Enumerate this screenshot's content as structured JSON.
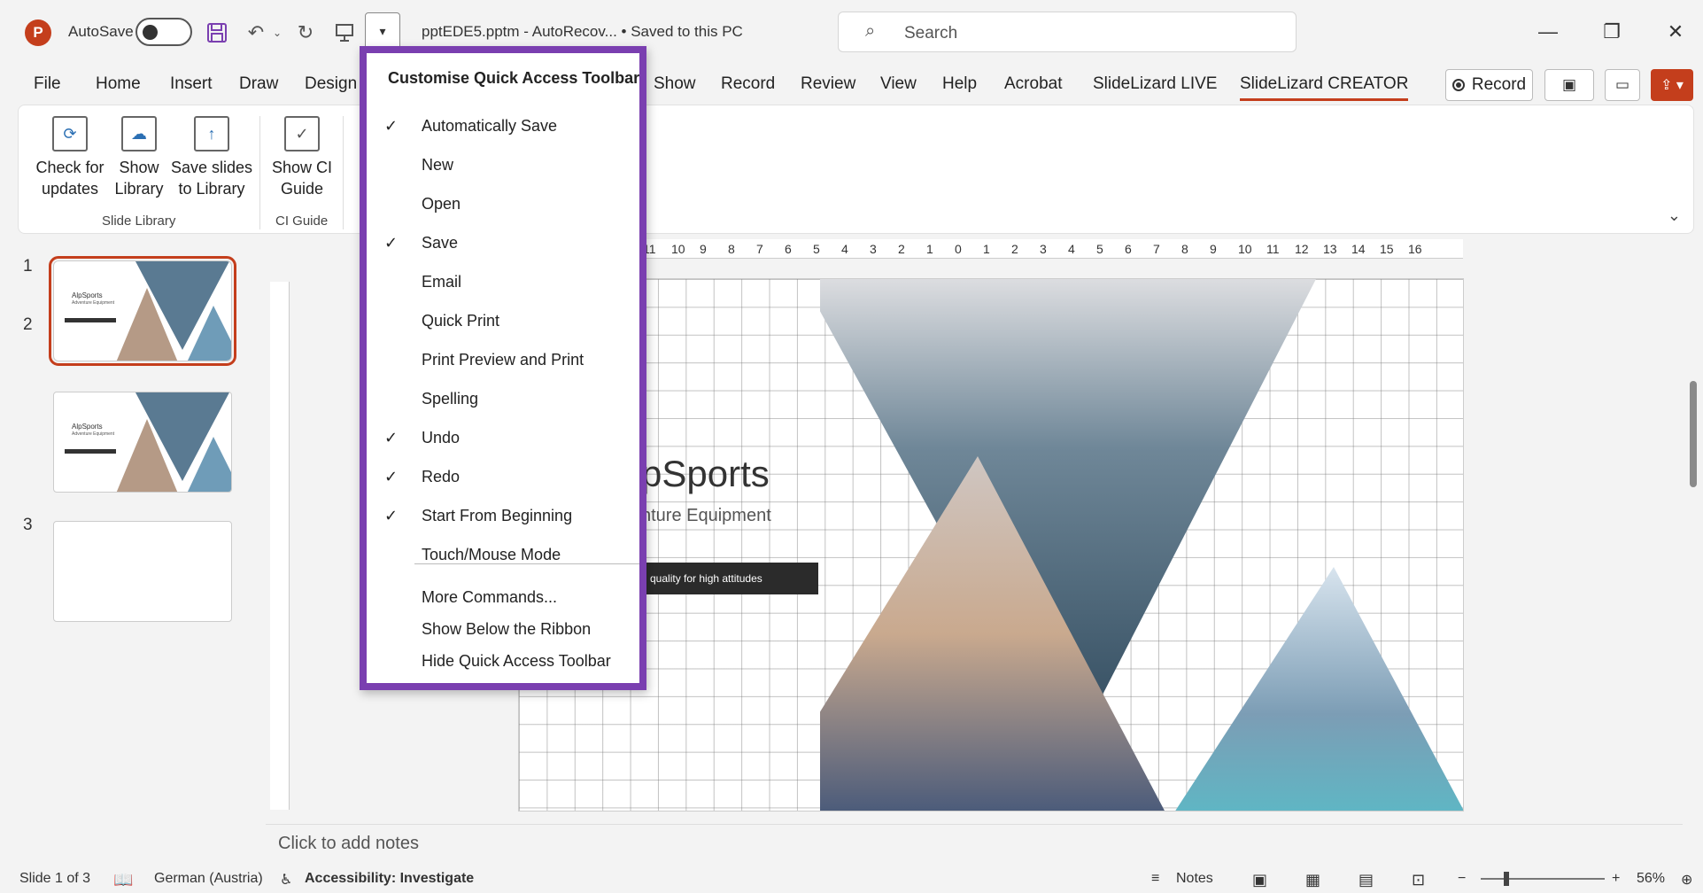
{
  "app": {
    "autosave_label": "AutoSave",
    "filename": "pptEDE5.pptm  -  AutoRecov...  •  Saved to this PC",
    "search_placeholder": "Search"
  },
  "tabs": [
    "File",
    "Home",
    "Insert",
    "Draw",
    "Design",
    "Show",
    "Record",
    "Review",
    "View",
    "Help",
    "Acrobat",
    "SlideLizard LIVE",
    "SlideLizard CREATOR"
  ],
  "active_tab": "SlideLizard CREATOR",
  "record_button": "Record",
  "ribbon": {
    "buttons": [
      {
        "line1": "Check for",
        "line2": "updates"
      },
      {
        "line1": "Show",
        "line2": "Library"
      },
      {
        "line1": "Save slides",
        "line2": "to Library"
      },
      {
        "line1": "Show CI",
        "line2": "Guide"
      }
    ],
    "groups": [
      "Slide Library",
      "CI Guide"
    ]
  },
  "slides": [
    {
      "number": "1",
      "title": "AlpSports",
      "subtitle": "Adventure Equipment",
      "bar": "High quality for high attitudes"
    },
    {
      "number": "2",
      "title": "AlpSports",
      "subtitle": "Adventure Equipment",
      "bar": "High quality for high attitudes"
    },
    {
      "number": "3"
    }
  ],
  "slide_content": {
    "title": "pSports",
    "subtitle": "nture Equipment",
    "bar": "quality for high attitudes"
  },
  "ruler_ticks": [
    "12",
    "11",
    "10",
    "9",
    "8",
    "7",
    "6",
    "5",
    "4",
    "3",
    "2",
    "1",
    "0",
    "1",
    "2",
    "3",
    "4",
    "5",
    "6",
    "7",
    "8",
    "9",
    "10",
    "11",
    "12",
    "13",
    "14",
    "15",
    "16"
  ],
  "qat_menu": {
    "header": "Customise Quick Access Toolbar",
    "items": [
      {
        "label": "Automatically Save",
        "checked": true
      },
      {
        "label": "New",
        "checked": false
      },
      {
        "label": "Open",
        "checked": false
      },
      {
        "label": "Save",
        "checked": true
      },
      {
        "label": "Email",
        "checked": false
      },
      {
        "label": "Quick Print",
        "checked": false
      },
      {
        "label": "Print Preview and Print",
        "checked": false
      },
      {
        "label": "Spelling",
        "checked": false
      },
      {
        "label": "Undo",
        "checked": true
      },
      {
        "label": "Redo",
        "checked": true
      },
      {
        "label": "Start From Beginning",
        "checked": true
      },
      {
        "label": "Touch/Mouse Mode",
        "checked": false
      }
    ],
    "extra_items": [
      "More Commands...",
      "Show Below the Ribbon",
      "Hide Quick Access Toolbar"
    ],
    "check_glyph": "✓"
  },
  "notes_placeholder": "Click to add notes",
  "statusbar": {
    "slide_info": "Slide 1 of 3",
    "language": "German (Austria)",
    "accessibility": "Accessibility: Investigate",
    "notes": "Notes",
    "zoom": "56%"
  },
  "colors": {
    "accent": "#c43e1c",
    "menu_border": "#7a3fb0"
  }
}
